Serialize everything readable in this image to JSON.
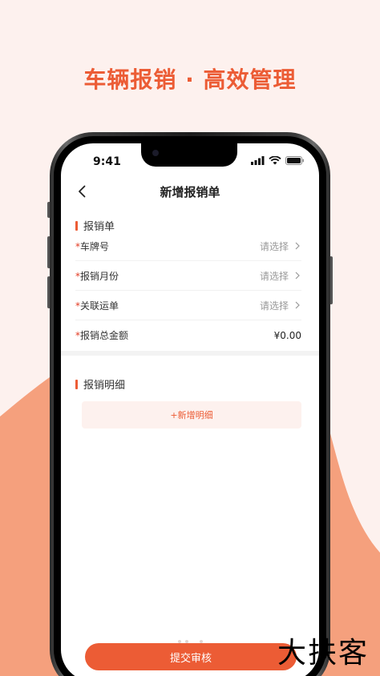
{
  "hero": {
    "title": "车辆报销 · 高效管理"
  },
  "status": {
    "time": "9:41"
  },
  "nav": {
    "title": "新增报销单"
  },
  "section1": {
    "title": "报销单"
  },
  "form": {
    "rows": [
      {
        "required": "*",
        "label": "车牌号",
        "value": "请选择",
        "type": "select"
      },
      {
        "required": "*",
        "label": "报销月份",
        "value": "请选择",
        "type": "select"
      },
      {
        "required": "*",
        "label": "关联运单",
        "value": "请选择",
        "type": "select"
      },
      {
        "required": "*",
        "label": "报销总金额",
        "value": "¥0.00",
        "type": "amount"
      }
    ]
  },
  "section2": {
    "title": "报销明细"
  },
  "add_detail_label": "+新增明细",
  "submit_label": "提交审核",
  "watermark": "大扶客",
  "colors": {
    "accent": "#ec5c35",
    "background": "#fdf1ee"
  },
  "icons": {
    "back": "chevron-left-icon",
    "row": "chevron-right-icon"
  }
}
